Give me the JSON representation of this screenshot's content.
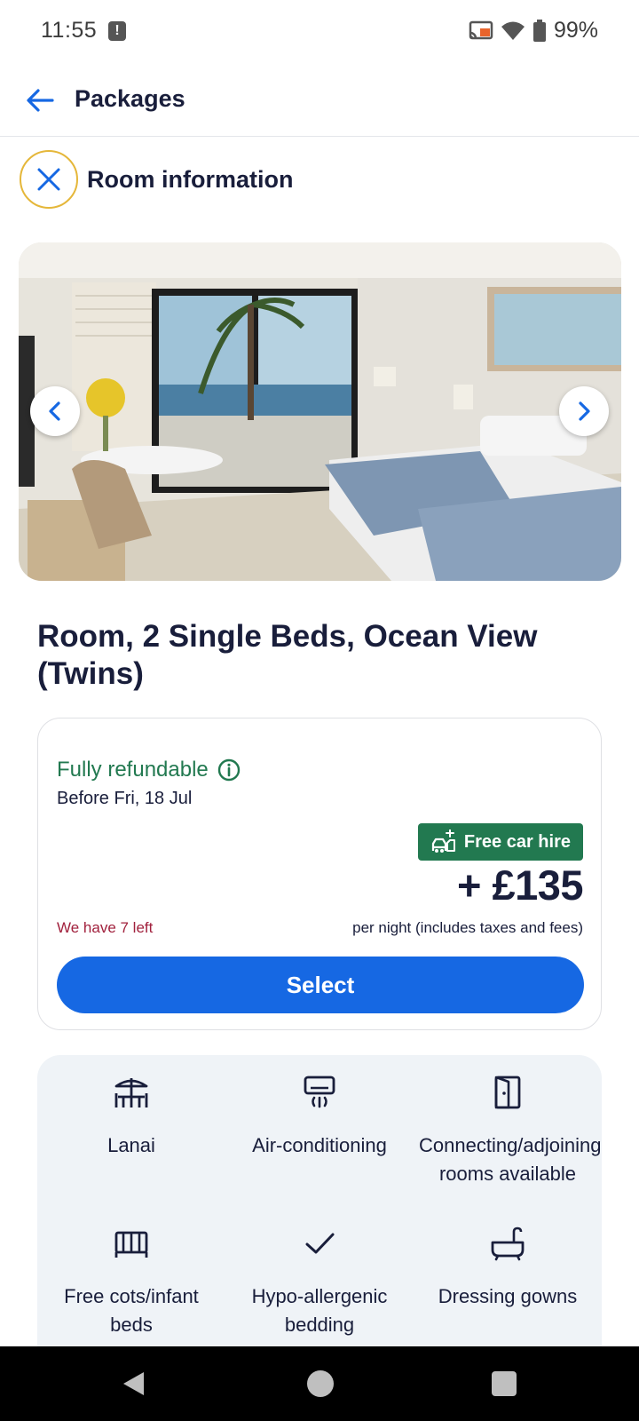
{
  "status_bar": {
    "time": "11:55",
    "battery": "99%"
  },
  "app_bar": {
    "title": "Packages"
  },
  "room_info": {
    "title": "Room information"
  },
  "room": {
    "title": "Room, 2 Single Beds, Ocean View (Twins)"
  },
  "price_card": {
    "refund_label": "Fully refundable",
    "refund_date": "Before Fri, 18 Jul",
    "badge_label": "Free car hire",
    "price": "+ £135",
    "per_night": "per night (includes taxes and fees)",
    "availability": "We have 7 left",
    "select_label": "Select"
  },
  "amenities": [
    {
      "label": "Lanai",
      "icon": "lanai-icon"
    },
    {
      "label": "Air-conditioning",
      "icon": "air-conditioning-icon"
    },
    {
      "label": "Connecting/adjoining rooms available",
      "icon": "door-icon"
    },
    {
      "label": "Free cots/infant beds",
      "icon": "cot-icon"
    },
    {
      "label": "Hypo-allergenic bedding",
      "icon": "checkmark-icon"
    },
    {
      "label": "Dressing gowns",
      "icon": "bathtub-icon"
    }
  ],
  "colors": {
    "accent": "#1668e3",
    "refund_green": "#227950",
    "warning_red": "#a1213d",
    "amenity_bg": "#eff3f7"
  }
}
